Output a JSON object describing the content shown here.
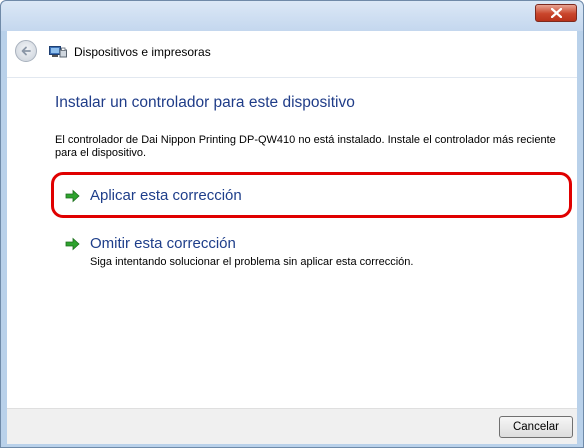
{
  "window": {
    "close_icon": "close-x-icon"
  },
  "nav": {
    "back_icon": "back-arrow-icon",
    "device_icon": "devices-printers-icon",
    "title": "Dispositivos e impresoras"
  },
  "main": {
    "heading": "Instalar un controlador para este dispositivo",
    "description": "El controlador de Dai Nippon Printing DP-QW410 no está instalado. Instale el controlador más reciente para el dispositivo.",
    "options": [
      {
        "label": "Aplicar esta corrección",
        "subtext": "",
        "icon": "green-arrow-icon"
      },
      {
        "label": "Omitir esta corrección",
        "subtext": "Siga intentando solucionar el problema sin aplicar esta corrección.",
        "icon": "green-arrow-icon"
      }
    ],
    "highlight_color": "#e00000"
  },
  "footer": {
    "cancel_label": "Cancelar"
  }
}
